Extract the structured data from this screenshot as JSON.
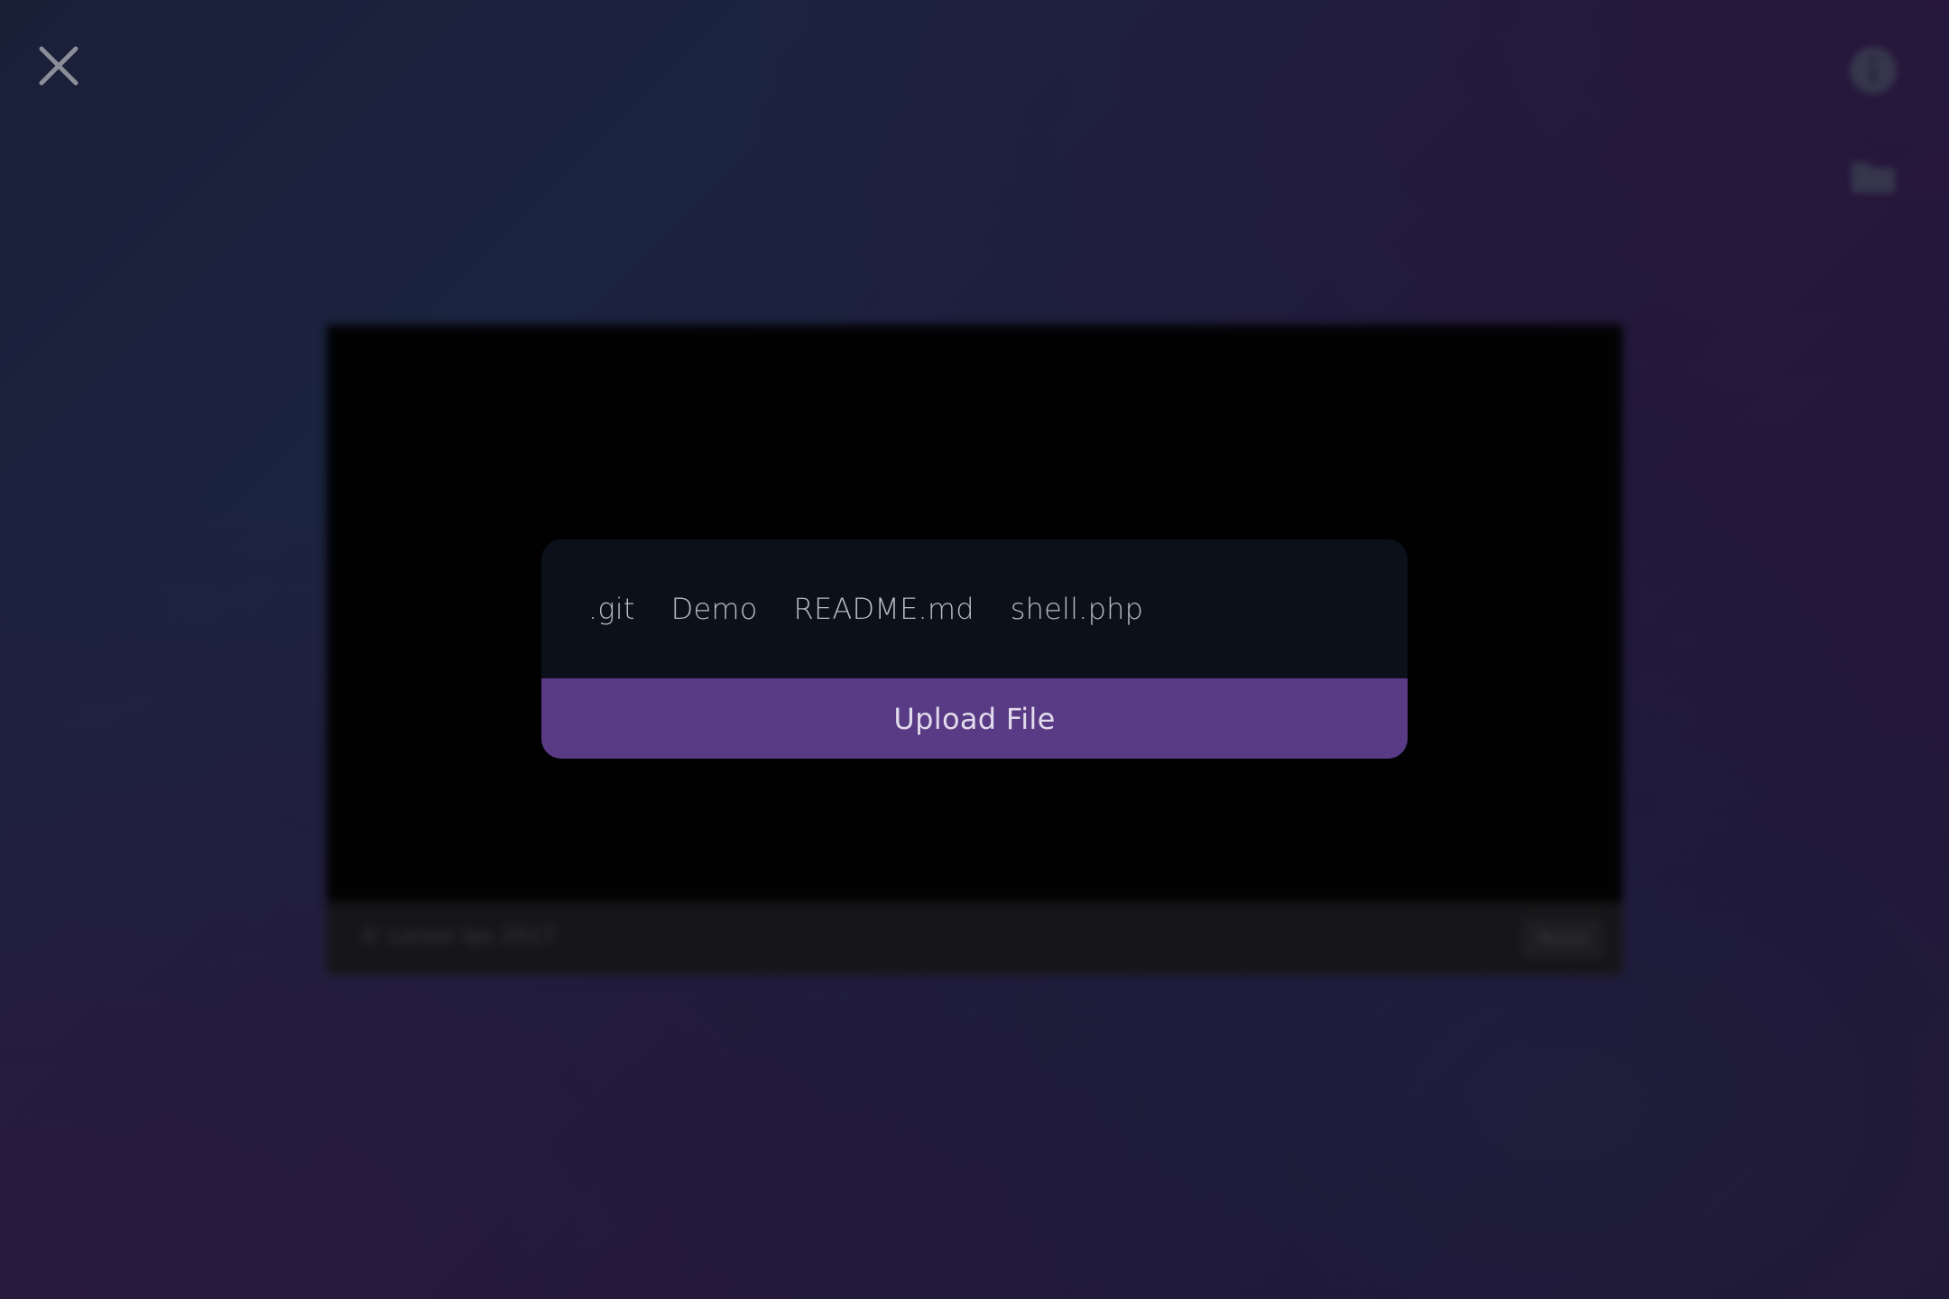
{
  "app": {
    "close_icon": "close-icon"
  },
  "top_right_controls": [
    {
      "icon": "info-icon"
    },
    {
      "icon": "folder-icon"
    }
  ],
  "background_window": {
    "footer_text": "© Lorem Ips 2017",
    "footer_button_label": "Reset"
  },
  "upload_dialog": {
    "files": [
      ".git",
      "Demo",
      "README.md",
      "shell.php"
    ],
    "upload_button_label": "Upload File"
  },
  "colors": {
    "accent": "#583a85",
    "dialog_bg": "#0c101a",
    "file_text": "#b9bcc6"
  }
}
